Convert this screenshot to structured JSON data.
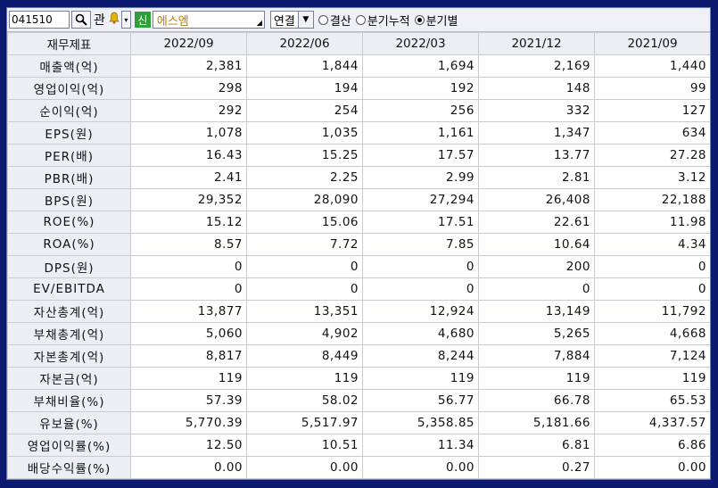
{
  "toolbar": {
    "code": "041510",
    "search_icon": "search-icon",
    "gwan_label": "관",
    "bell_icon": "bell-icon",
    "badge": "신",
    "stock_name": "에스엠",
    "consolidation": "연결",
    "radio_options": [
      {
        "label": "결산",
        "selected": false
      },
      {
        "label": "분기누적",
        "selected": false
      },
      {
        "label": "분기별",
        "selected": true
      }
    ]
  },
  "table": {
    "header_label": "재무제표",
    "periods": [
      "2022/09",
      "2022/06",
      "2022/03",
      "2021/12",
      "2021/09"
    ],
    "rows": [
      {
        "label": "매출액(억)",
        "values": [
          "2,381",
          "1,844",
          "1,694",
          "2,169",
          "1,440"
        ]
      },
      {
        "label": "영업이익(억)",
        "values": [
          "298",
          "194",
          "192",
          "148",
          "99"
        ]
      },
      {
        "label": "순이익(억)",
        "values": [
          "292",
          "254",
          "256",
          "332",
          "127"
        ]
      },
      {
        "label": "EPS(원)",
        "values": [
          "1,078",
          "1,035",
          "1,161",
          "1,347",
          "634"
        ]
      },
      {
        "label": "PER(배)",
        "values": [
          "16.43",
          "15.25",
          "17.57",
          "13.77",
          "27.28"
        ]
      },
      {
        "label": "PBR(배)",
        "values": [
          "2.41",
          "2.25",
          "2.99",
          "2.81",
          "3.12"
        ]
      },
      {
        "label": "BPS(원)",
        "values": [
          "29,352",
          "28,090",
          "27,294",
          "26,408",
          "22,188"
        ]
      },
      {
        "label": "ROE(%)",
        "values": [
          "15.12",
          "15.06",
          "17.51",
          "22.61",
          "11.98"
        ]
      },
      {
        "label": "ROA(%)",
        "values": [
          "8.57",
          "7.72",
          "7.85",
          "10.64",
          "4.34"
        ]
      },
      {
        "label": "DPS(원)",
        "values": [
          "0",
          "0",
          "0",
          "200",
          "0"
        ]
      },
      {
        "label": "EV/EBITDA",
        "values": [
          "0",
          "0",
          "0",
          "0",
          "0"
        ]
      },
      {
        "label": "자산총계(억)",
        "values": [
          "13,877",
          "13,351",
          "12,924",
          "13,149",
          "11,792"
        ]
      },
      {
        "label": "부채총계(억)",
        "values": [
          "5,060",
          "4,902",
          "4,680",
          "5,265",
          "4,668"
        ]
      },
      {
        "label": "자본총계(억)",
        "values": [
          "8,817",
          "8,449",
          "8,244",
          "7,884",
          "7,124"
        ]
      },
      {
        "label": "자본금(억)",
        "values": [
          "119",
          "119",
          "119",
          "119",
          "119"
        ]
      },
      {
        "label": "부채비율(%)",
        "values": [
          "57.39",
          "58.02",
          "56.77",
          "66.78",
          "65.53"
        ]
      },
      {
        "label": "유보율(%)",
        "values": [
          "5,770.39",
          "5,517.97",
          "5,358.85",
          "5,181.66",
          "4,337.57"
        ]
      },
      {
        "label": "영업이익률(%)",
        "values": [
          "12.50",
          "10.51",
          "11.34",
          "6.81",
          "6.86"
        ]
      },
      {
        "label": "배당수익률(%)",
        "values": [
          "0.00",
          "0.00",
          "0.00",
          "0.27",
          "0.00"
        ]
      }
    ]
  }
}
